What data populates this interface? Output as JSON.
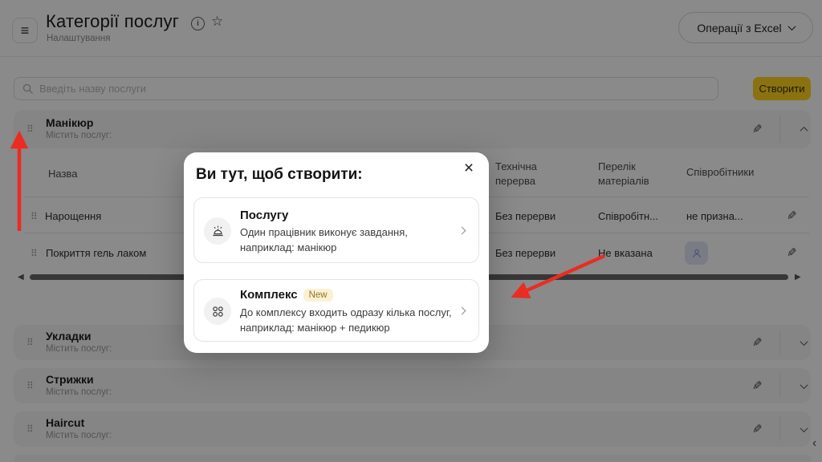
{
  "header": {
    "title": "Категорії послуг",
    "subtitle": "Налаштування",
    "excel_button_label": "Операції з Excel"
  },
  "toolbar": {
    "search_placeholder": "Введіть назву послуги",
    "create_button_label": "Створити"
  },
  "category_expanded": {
    "name": "Манікюр",
    "contains_label": "Містить послуг:"
  },
  "table": {
    "col_name": "Назва",
    "col_tech_break": "Технічна перерва",
    "col_materials": "Перелік матеріалів",
    "col_staff": "Співробітники",
    "rows": [
      {
        "name": "Нарощення",
        "tech_break": "Без перерви",
        "materials": "Співробітн...",
        "staff": "не призна..."
      },
      {
        "name": "Покриття гель лаком",
        "tech_break": "Без перерви",
        "materials": "Не вказана",
        "staff": ""
      }
    ]
  },
  "categories_collapsed": [
    {
      "name": "Укладки",
      "contains_label": "Містить послуг:"
    },
    {
      "name": "Стрижки",
      "contains_label": "Містить послуг:"
    },
    {
      "name": "Haircut",
      "contains_label": "Містить послуг:"
    }
  ],
  "modal": {
    "title": "Ви тут, щоб створити:",
    "options": [
      {
        "title": "Послугу",
        "desc_line1": "Один працівник виконує завдання,",
        "desc_line2": "наприклад: манікюр"
      },
      {
        "title": "Комплекс",
        "badge": "New",
        "desc_line1": "До комплексу входить одразу кілька послуг,",
        "desc_line2": "наприклад: манікюр + педикюр"
      }
    ]
  },
  "icons": {
    "menu": "≡",
    "info": "i",
    "star": "☆",
    "close": "×",
    "drag": "⠿",
    "pencil": "✎",
    "scroll_left": "◀",
    "scroll_right": "▶",
    "panel_collapse": "‹"
  },
  "colors": {
    "accent_yellow": "#ffd21e",
    "badge_bg": "#fbf1d2",
    "badge_text": "#93752a",
    "arrow_red": "#ea2c22"
  }
}
